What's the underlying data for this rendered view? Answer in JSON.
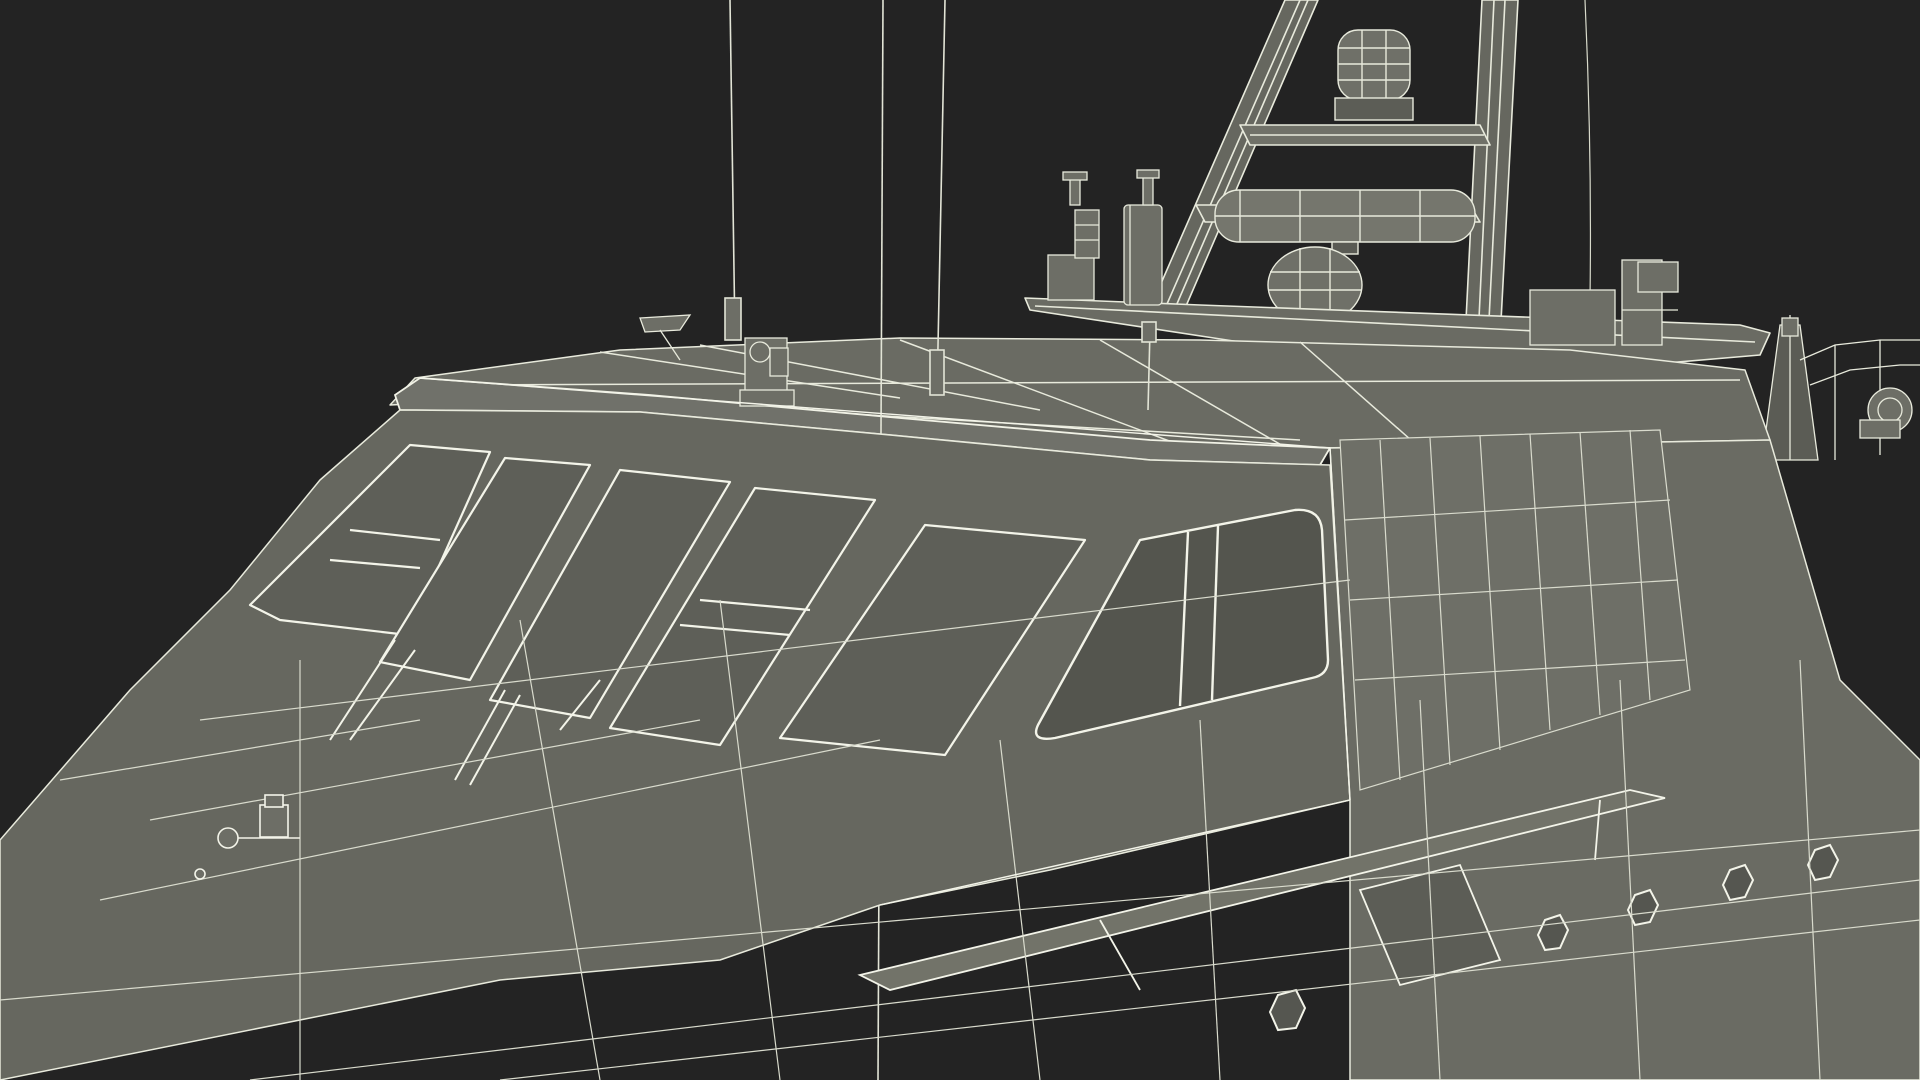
{
  "scene": {
    "subject": "wireframe-3d-boat-cabin",
    "colors": {
      "background": "#232323",
      "hull": "#66675f",
      "hull_dark": "#55564f",
      "hull_light": "#76776e",
      "glass": "#4c4d47",
      "wire": "#e8eadc",
      "wire_faint": "#c9cbbd"
    },
    "icons": [
      "antenna-icon",
      "radar-dome-icon",
      "radar-bar-icon",
      "mast-icon",
      "porthole-icon",
      "searchlight-icon",
      "railing-icon"
    ]
  }
}
